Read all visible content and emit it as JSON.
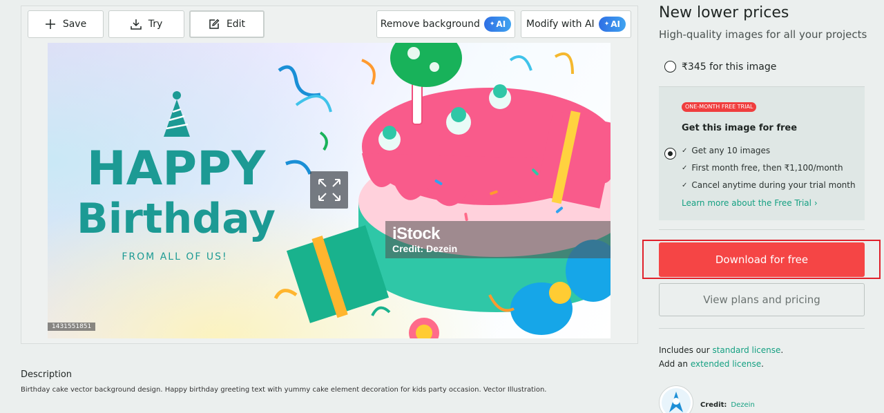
{
  "toolbar": {
    "save_label": "Save",
    "try_label": "Try",
    "edit_label": "Edit",
    "remove_bg_label": "Remove background",
    "modify_ai_label": "Modify with AI",
    "ai_badge": "AI"
  },
  "image": {
    "watermark_brand": "iStock",
    "watermark_credit": "Credit: Dezein",
    "image_id": "1431551851",
    "art_text_happy": "HAPPY",
    "art_text_birthday": "Birthday",
    "art_text_from": "FROM ALL OF US!"
  },
  "description": {
    "title": "Description",
    "text": "Birthday cake vector background design. Happy birthday greeting text with yummy cake element decoration for kids party occasion. Vector Illustration."
  },
  "pricing": {
    "heading": "New lower prices",
    "subheading": "High-quality images for all your projects",
    "single_price_label": "₹345 for this image",
    "trial_badge": "ONE-MONTH FREE TRIAL",
    "trial_title": "Get this image for free",
    "trial_features": [
      "Get any 10 images",
      "First month free, then ₹1,100/month",
      "Cancel anytime during your trial month"
    ],
    "trial_link": "Learn more about the Free Trial ›",
    "download_label": "Download for free",
    "plans_label": "View plans and pricing"
  },
  "license": {
    "line1_prefix": "Includes our ",
    "line1_link": "standard license",
    "line1_suffix": ".",
    "line2_prefix": "Add an ",
    "line2_link": "extended license",
    "line2_suffix": "."
  },
  "credit": {
    "label": "Credit:",
    "name": "Dezein"
  },
  "colors": {
    "accent_green": "#15a082",
    "download_red": "#f54545",
    "badge_red": "#f03e3e",
    "ai_blue": "#2f6fe4"
  }
}
